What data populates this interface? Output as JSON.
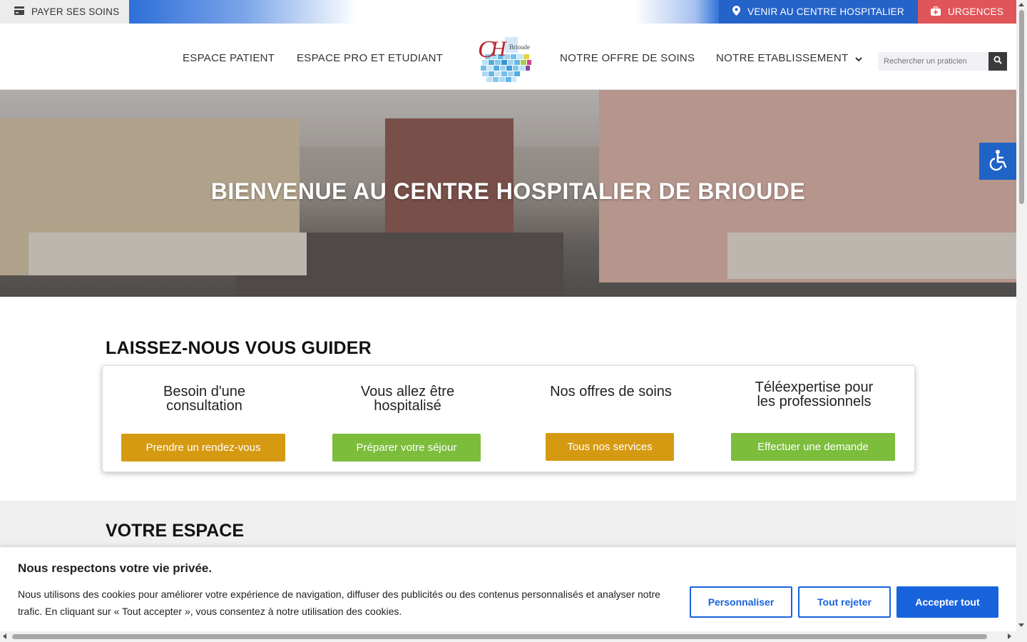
{
  "topbar": {
    "pay_label": "PAYER SES SOINS",
    "venir_label": "VENIR AU CENTRE HOSPITALIER",
    "urgences_label": "URGENCES"
  },
  "nav": {
    "items": [
      "ESPACE PATIENT",
      "ESPACE PRO ET ETUDIANT",
      "NOTRE OFFRE DE SOINS",
      "NOTRE ETABLISSEMENT"
    ],
    "logo_text": "Brioude",
    "search_placeholder": "Rechercher un praticien"
  },
  "hero": {
    "title": "BIENVENUE AU CENTRE HOSPITALIER DE BRIOUDE"
  },
  "guide": {
    "title": "LAISSEZ-NOUS VOUS GUIDER",
    "cards": [
      {
        "text_1": "Besoin d'une",
        "text_2": "consultation",
        "button": "Prendre un rendez-vous"
      },
      {
        "text_1": "Vous allez être",
        "text_2": "hospitalisé",
        "button": "Préparer votre séjour"
      },
      {
        "text_1": "Nos offres de soins",
        "text_2": "",
        "button": "Tous nos services"
      },
      {
        "text_1": "Téléexpertise pour",
        "text_2": "les professionnels",
        "button": "Effectuer une demande"
      }
    ]
  },
  "espace": {
    "title": "VOTRE ESPACE"
  },
  "cookie": {
    "title": "Nous respectons votre vie privée.",
    "text": "Nous utilisons des cookies pour améliorer votre expérience de navigation, diffuser des publicités ou des contenus personnalisés et analyser notre trafic. En cliquant sur « Tout accepter », vous consentez à notre utilisation des cookies.",
    "customize": "Personnaliser",
    "reject": "Tout rejeter",
    "accept": "Accepter tout"
  },
  "colors": {
    "blue": "#2563c9",
    "red": "#e0555a",
    "gold": "#d69a12",
    "green": "#7cbd3b",
    "cookie_blue": "#1863dc"
  }
}
